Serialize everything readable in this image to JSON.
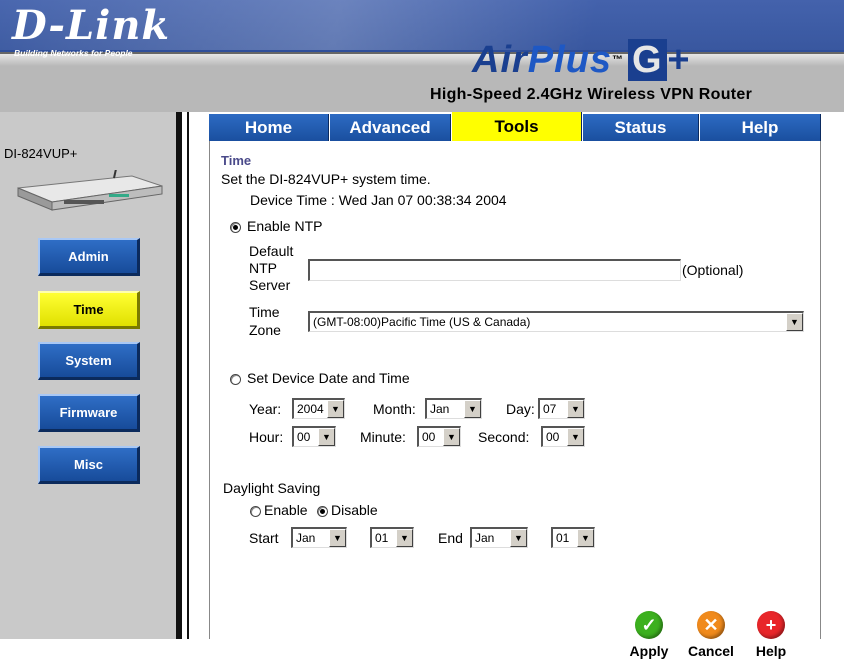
{
  "brand": {
    "logo": "D-Link",
    "tagline": "Building Networks for People"
  },
  "product": {
    "logo_air": "Air",
    "logo_plus": "Plus",
    "logo_tm": "™",
    "logo_g": "G",
    "logo_gplus": "+",
    "title": "High-Speed 2.4GHz Wireless VPN Router",
    "model": "DI-824VUP+"
  },
  "tabs": [
    {
      "label": "Home"
    },
    {
      "label": "Advanced"
    },
    {
      "label": "Tools",
      "active": true
    },
    {
      "label": "Status"
    },
    {
      "label": "Help"
    }
  ],
  "sidebar": {
    "items": [
      {
        "label": "Admin"
      },
      {
        "label": "Time",
        "active": true
      },
      {
        "label": "System"
      },
      {
        "label": "Firmware"
      },
      {
        "label": "Misc"
      }
    ]
  },
  "main": {
    "section_title": "Time",
    "description": "Set the DI-824VUP+ system time.",
    "device_time": "Device Time : Wed Jan 07 00:38:34 2004",
    "enable_ntp": "Enable NTP",
    "ntp_label_1": "Default",
    "ntp_label_2": "NTP",
    "ntp_label_3": "Server",
    "ntp_value": "",
    "ntp_optional": "(Optional)",
    "tz_label_1": "Time",
    "tz_label_2": "Zone",
    "tz_value": "(GMT-08:00)Pacific Time (US & Canada)",
    "set_device": "Set Device Date and Time",
    "year_label": "Year:",
    "year_value": "2004",
    "month_label": "Month:",
    "month_value": "Jan",
    "day_label": "Day:",
    "day_value": "07",
    "hour_label": "Hour:",
    "hour_value": "00",
    "minute_label": "Minute:",
    "minute_value": "00",
    "second_label": "Second:",
    "second_value": "00",
    "dst_title": "Daylight Saving",
    "dst_enable": "Enable",
    "dst_disable": "Disable",
    "start_label": "Start",
    "start_month": "Jan",
    "start_day": "01",
    "end_label": "End",
    "end_month": "Jan",
    "end_day": "01"
  },
  "actions": {
    "apply": "Apply",
    "cancel": "Cancel",
    "help": "Help",
    "apply_icon": "checkmark-icon",
    "cancel_icon": "x-icon",
    "help_icon": "plus-icon"
  },
  "colors": {
    "header_blue": "#2e4e9a",
    "tab_blue": "#1a4f9f",
    "active_yellow": "#ffff00",
    "apply_green": "#3cb01e",
    "cancel_orange": "#f08a1c",
    "help_red": "#e8262a"
  }
}
